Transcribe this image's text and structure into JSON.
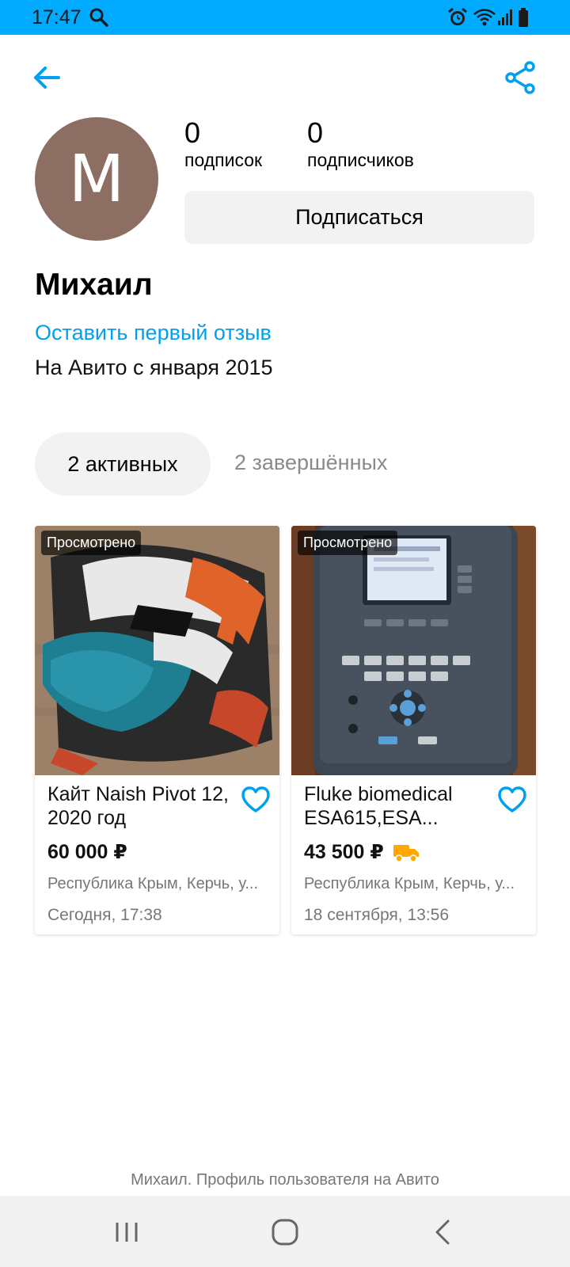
{
  "status_bar": {
    "time": "17:47",
    "icons": [
      "search-icon",
      "alarm-icon",
      "wifi-icon",
      "signal-icon",
      "battery-icon"
    ],
    "background": "#00aaff"
  },
  "toolbar": {
    "back_icon": "arrow-left-icon",
    "share_icon": "share-icon",
    "accent": "#00a0f0"
  },
  "profile": {
    "avatar_letter": "M",
    "avatar_color": "#8d6e63",
    "subscriptions_count": "0",
    "subscriptions_label": "подписок",
    "followers_count": "0",
    "followers_label": "подписчиков",
    "subscribe_label": "Подписаться",
    "name": "Михаил",
    "review_link": "Оставить первый отзыв",
    "member_since": "На Авито с января 2015"
  },
  "tabs": {
    "active_label": "2 активных",
    "completed_label": "2 завершённых"
  },
  "listings": [
    {
      "badge": "Просмотрено",
      "title": "Кайт Naish Pivot 12, 2020 год",
      "price": "60 000 ₽",
      "address": "Республика Крым, Керчь, у...",
      "date": "Сегодня, 17:38",
      "delivery": false
    },
    {
      "badge": "Просмотрено",
      "title": "Fluke biomedical ESA615,ESA...",
      "price": "43 500 ₽",
      "address": "Республика Крым, Керчь, у...",
      "date": "18 сентября, 13:56",
      "delivery": true
    }
  ],
  "footer": {
    "caption": "Михаил. Профиль пользователя на Авито"
  },
  "nav_bar": {
    "icons": [
      "recents-icon",
      "home-icon",
      "back-icon"
    ]
  }
}
